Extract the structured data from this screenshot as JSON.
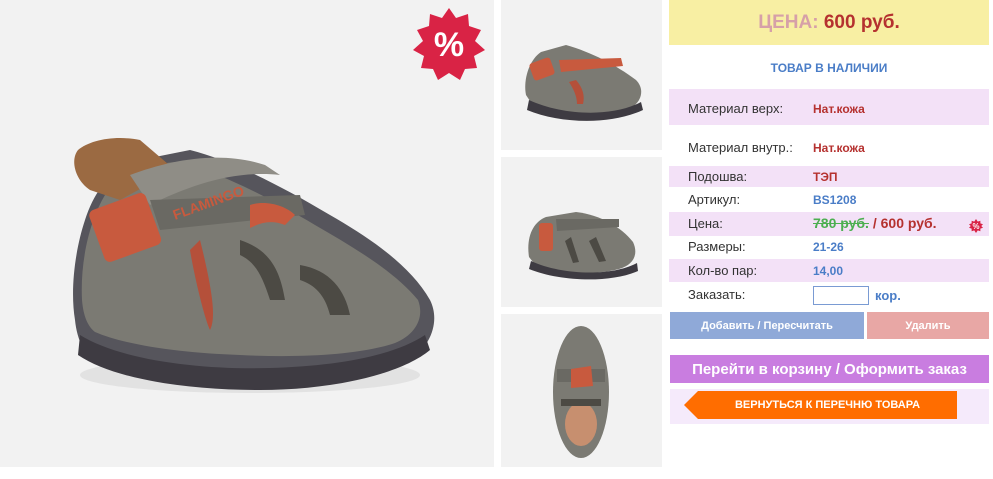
{
  "price_header": {
    "label": "ЦЕНА:",
    "value": "600 руб."
  },
  "stock_status": "ТОВАР В НАЛИЧИИ",
  "details": [
    {
      "key": "Материал верх:",
      "value": "Нат.кожа"
    },
    {
      "key": "Материал внутр.:",
      "value": "Нат.кожа"
    },
    {
      "key": "Подошва:",
      "value": "ТЭП"
    },
    {
      "key": "Артикул:",
      "value": "BS1208"
    },
    {
      "key": "Цена:",
      "old_value": "780 руб.",
      "separator": " / ",
      "new_value": "600 руб."
    },
    {
      "key": "Размеры:",
      "value": "21-26"
    },
    {
      "key": "Кол-во пар:",
      "value": "14,00"
    },
    {
      "key": "Заказать:",
      "unit": "кор."
    }
  ],
  "buttons": {
    "add": "Добавить / Пересчитать",
    "delete": "Удалить",
    "cart": "Перейти в корзину / Оформить заказ",
    "back": "ВЕРНУТЬСЯ К ПЕРЕЧНЮ ТОВАРА"
  },
  "badge": {
    "symbol": "%"
  },
  "colors": {
    "price_header_bg": "#f8efa3",
    "accent_red": "#b5312f",
    "accent_blue": "#4a7dc7",
    "pink_row": "#f3e1f7",
    "old_price_green": "#4caf50",
    "cart_purple": "#c97de0",
    "back_orange": "#ff6d00"
  },
  "icons": [
    "sale-percent-icon",
    "mini-percent-icon",
    "back-arrow-icon"
  ]
}
